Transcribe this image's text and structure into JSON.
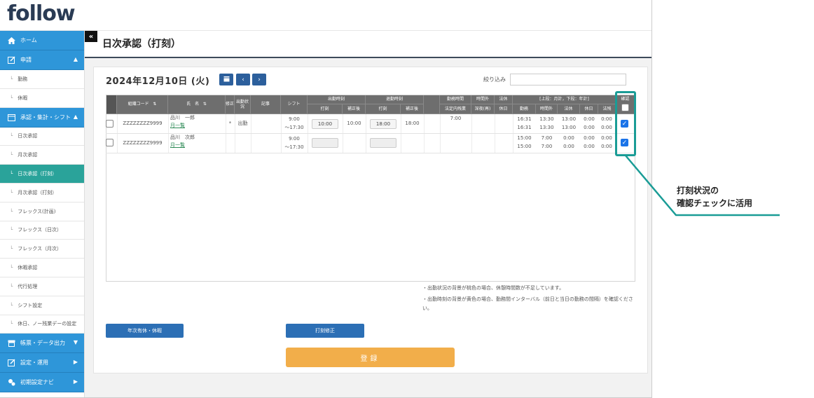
{
  "app": {
    "logo": "follow"
  },
  "sidebar": {
    "home": {
      "label": "ホーム",
      "icon": "home-icon"
    },
    "request": {
      "label": "申請",
      "icon": "edit-icon",
      "items": [
        "勤務",
        "休暇"
      ]
    },
    "approval": {
      "label": "承認・集計・シフト",
      "icon": "calendar-icon",
      "items": [
        "日次承認",
        "月次承認",
        "日次承認（打刻）",
        "月次承認（打刻）",
        "フレックス(計画)",
        "フレックス（日次）",
        "フレックス（月次）",
        "休暇承認",
        "代行処理",
        "シフト設定",
        "休日、ノー残業デーの設定"
      ],
      "active_index": 2
    },
    "reports": {
      "label": "帳票・データ出力",
      "icon": "report-icon"
    },
    "settings": {
      "label": "設定・運用",
      "icon": "settings-icon"
    },
    "initial": {
      "label": "初期設定ナビ",
      "icon": "gears-icon"
    }
  },
  "header": {
    "collapse": "«",
    "title": "日次承認（打刻）"
  },
  "toolbar": {
    "date": "2024年12月10日 (火)",
    "filter_label": "絞り込み",
    "filter_value": ""
  },
  "table": {
    "headers": {
      "org_code": "組織コード",
      "name": "氏　名",
      "fix": "修正",
      "attend_status": "出勤状況",
      "note": "記事",
      "shift": "シフト",
      "clock_in": "出勤時刻",
      "clock_out": "退勤時刻",
      "punch": "打刻",
      "corrected": "補正後",
      "work_hours": "勤務時間",
      "legal_overtime": "法定内残業",
      "overtime": "時間外",
      "late_night": "深夜(再)",
      "legal_holiday": "法休",
      "holiday": "休日",
      "summary": "[上段：月計，下段：年計]",
      "work": "勤務",
      "overtime2": "時間外",
      "legal_holiday2": "法休",
      "holiday2": "休日",
      "legal_ot2": "法残",
      "confirm": "確認"
    },
    "rows": [
      {
        "org": "ZZZZZZZZ9999",
        "name": "品川　一郎",
        "link": "月一覧",
        "fix": "*",
        "status": "出勤",
        "shift_start": "9:00",
        "shift_end": "～17:30",
        "in_punch": "10:00",
        "in_corrected": "10:00",
        "out_punch": "18:00",
        "out_corrected": "18:00",
        "work_time": "7:00",
        "totals_top": [
          "16:31",
          "13:30",
          "13:00",
          "0:00",
          "0:00"
        ],
        "totals_bottom": [
          "16:31",
          "13:30",
          "13:00",
          "0:00",
          "0:00"
        ],
        "confirmed": true
      },
      {
        "org": "ZZZZZZZZ9999",
        "name": "品川　次郎",
        "link": "月一覧",
        "fix": "",
        "status": "",
        "shift_start": "9:00",
        "shift_end": "～17:30",
        "in_punch": "",
        "in_corrected": "",
        "out_punch": "",
        "out_corrected": "",
        "work_time": "",
        "totals_top": [
          "15:00",
          "7:00",
          "0:00",
          "0:00",
          "0:00"
        ],
        "totals_bottom": [
          "15:00",
          "7:00",
          "0:00",
          "0:00",
          "0:00"
        ],
        "confirmed": true
      }
    ]
  },
  "notes": [
    "・出勤状況の背景が桃色の場合、休憩時間数が不足しています。",
    "・出勤時刻の背景が黄色の場合、勤務間インターバル（前日と当日の勤務の間隔）を確認ください。"
  ],
  "buttons": {
    "annual_leave": "年次有休・休暇",
    "punch_fix": "打刻修正",
    "register": "登録"
  },
  "annotation": {
    "line1": "打刻状況の",
    "line2": "確認チェックに活用",
    "color": "#1a9c96"
  },
  "colors": {
    "sidebar_blue": "#2e96d9",
    "active_teal": "#2aa39a",
    "button_blue": "#2c6fb5",
    "register_orange": "#f2ae4a"
  }
}
